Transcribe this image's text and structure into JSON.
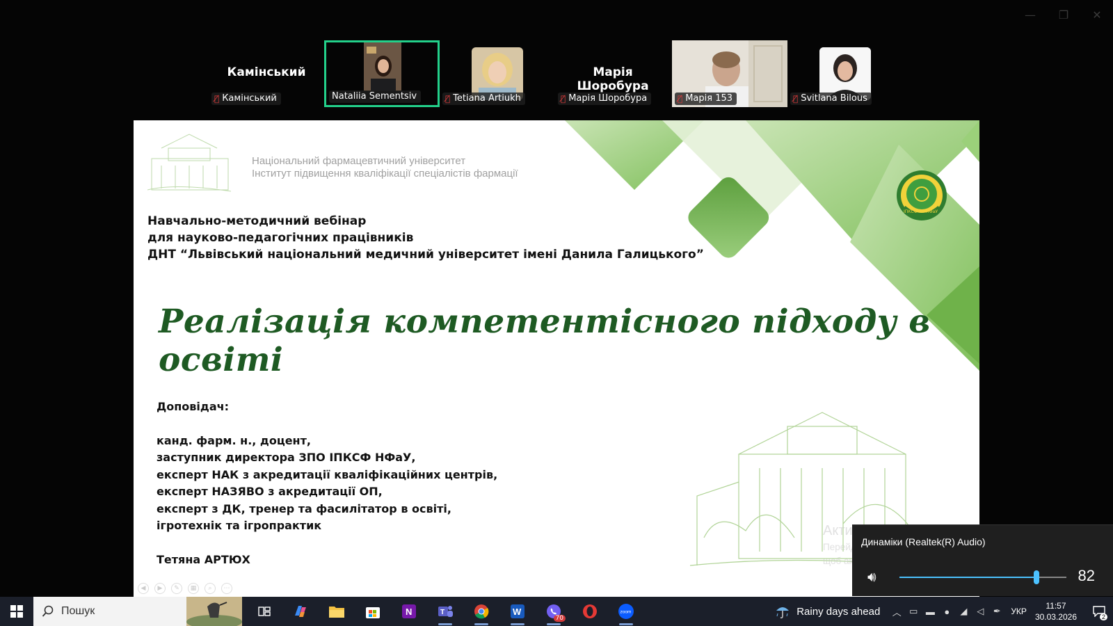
{
  "window": {
    "controls": [
      "—",
      "❐",
      "✕"
    ]
  },
  "participants": [
    {
      "display": "Камінський",
      "label": "Камінський",
      "muted": true,
      "video": "none"
    },
    {
      "display": "",
      "label": "Nataliia Sementsiv",
      "muted": false,
      "video": "photo",
      "speaking": true
    },
    {
      "display": "",
      "label": "Tetiana Artiukh",
      "muted": true,
      "video": "photo"
    },
    {
      "display": "Марія Шоробура",
      "label": "Марія Шоробура",
      "muted": true,
      "video": "none"
    },
    {
      "display": "",
      "label": "Марія 153",
      "muted": true,
      "video": "camera"
    },
    {
      "display": "",
      "label": "Svitlana Bilous",
      "muted": true,
      "video": "photo"
    }
  ],
  "slide": {
    "university_line1": "Національний фармацевтичний університет",
    "university_line2": "Інститут підвищення кваліфікації спеціалістів фармації",
    "event_line1": "Навчально-методичний вебінар",
    "event_line2": "для науково-педагогічних працівників",
    "event_line3": "ДНТ “Львівський національний медичний університет імені Данила Галицького”",
    "title": "Реалізація компетентісного підходу в освіті",
    "reporter_label": "Доповідач:",
    "reporter_lines": [
      "канд. фарм. н., доцент,",
      "заступник директора ЗПО ІПКСФ НФаУ,",
      "експерт НАК з акредитації кваліфікаційних центрів,",
      "експерт НАЗЯВО з акредитації ОП,",
      "експерт з ДК, тренер та фасилітатор в освіті,",
      "ігротехнік та ігропрактик"
    ],
    "reporter_name": "Тетяна АРТЮХ",
    "logo_text_left": "ІПКСФ",
    "logo_text_right": "НФаУ",
    "accent_green": "#1e5a23",
    "deco_green": "#8cc56a"
  },
  "activation": {
    "title": "Активація Windows",
    "text": "Перейдіть до розділу \"Настройки\", щоб активувати Windows."
  },
  "volume": {
    "device": "Динаміки (Realtek(R) Audio)",
    "level": 82,
    "accent": "#4cc2ff"
  },
  "taskbar": {
    "search_placeholder": "Пошук",
    "apps": [
      {
        "icon": "task-view-icon",
        "running": false
      },
      {
        "icon": "copilot-icon",
        "running": false
      },
      {
        "icon": "file-explorer-icon",
        "running": false
      },
      {
        "icon": "store-icon",
        "running": false
      },
      {
        "icon": "onenote-icon",
        "running": false
      },
      {
        "icon": "teams-icon",
        "running": true
      },
      {
        "icon": "chrome-icon",
        "running": true
      },
      {
        "icon": "word-icon",
        "running": true
      },
      {
        "icon": "viber-icon",
        "running": true,
        "badge": "70"
      },
      {
        "icon": "opera-icon",
        "running": false
      },
      {
        "icon": "zoom-icon",
        "running": true
      }
    ],
    "weather": "Rainy days ahead",
    "language": "УКР",
    "time": "11:57",
    "date": "30.03.2026",
    "notifications": "2"
  }
}
